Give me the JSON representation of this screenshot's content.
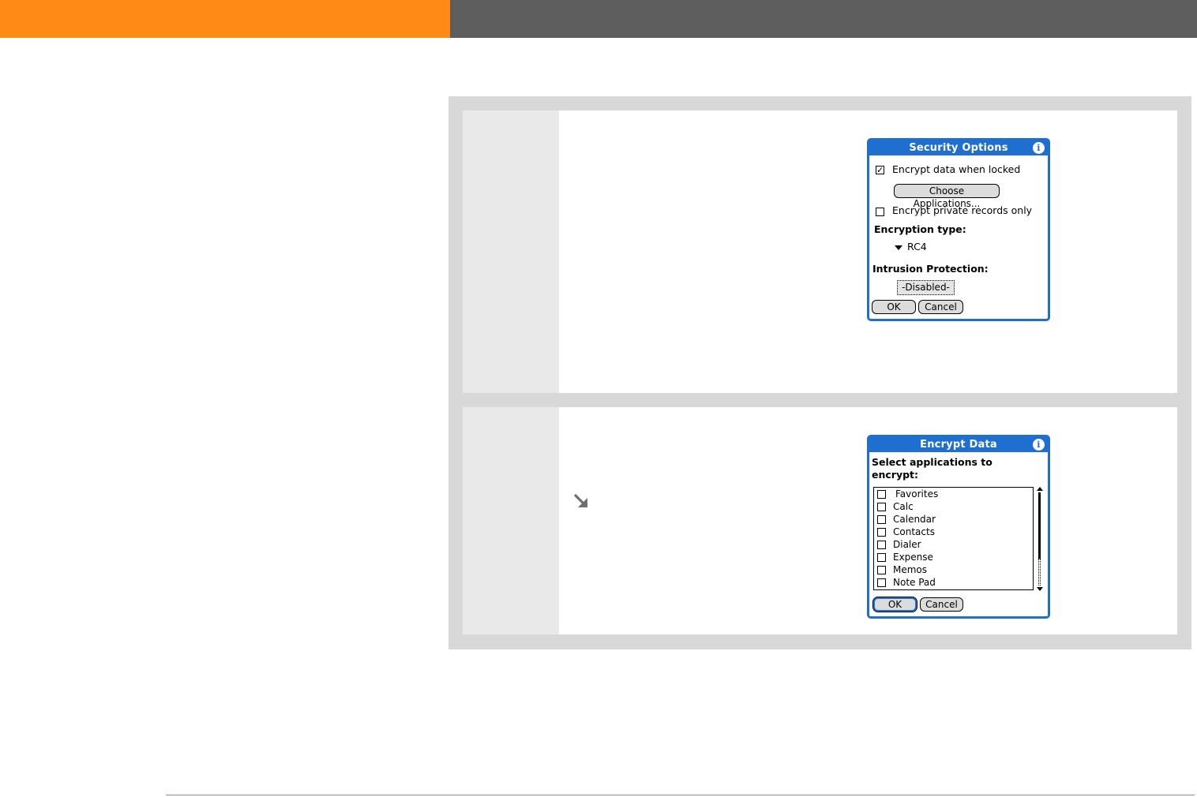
{
  "colors": {
    "header_accent": "#ff8a16",
    "header_dark": "#5e5e5e",
    "dialog_blue": "#1e6fd0"
  },
  "security_options": {
    "title": "Security Options",
    "info_icon": "info-icon",
    "encrypt_when_locked": {
      "label": "Encrypt data when locked",
      "checked": true,
      "mark": "✓"
    },
    "choose_apps_button": "Choose Applications...",
    "encrypt_private_only": {
      "label": "Encrypt private records only",
      "checked": false
    },
    "encryption_type_label": "Encryption type:",
    "encryption_type_value": "RC4",
    "intrusion_label": "Intrusion Protection:",
    "intrusion_value": "-Disabled-",
    "ok": "OK",
    "cancel": "Cancel"
  },
  "encrypt_data": {
    "title": "Encrypt Data",
    "info_icon": "info-icon",
    "prompt_line1": "Select applications to",
    "prompt_line2": "encrypt:",
    "apps": [
      "Favorites",
      "Calc",
      "Calendar",
      "Contacts",
      "Dialer",
      "Expense",
      "Memos",
      "Note Pad"
    ],
    "ok": "OK",
    "cancel": "Cancel"
  },
  "tip_icon": "tip-arrow-icon"
}
